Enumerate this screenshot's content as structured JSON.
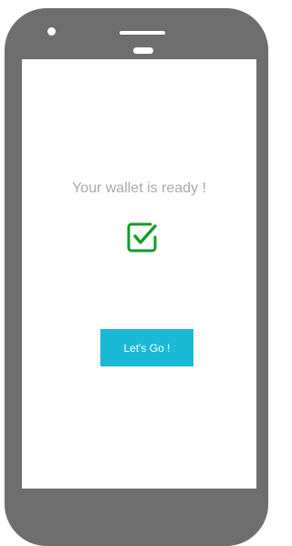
{
  "screen": {
    "message": "Your wallet is ready !",
    "icon": "checkbox-checked-icon",
    "cta_label": "Let's Go !"
  },
  "colors": {
    "device_frame": "#6e6e6e",
    "screen_bg": "#ffffff",
    "message_text": "#a9a9a9",
    "check_icon": "#119c2a",
    "cta_bg": "#1ab9d6",
    "cta_text": "#ffffff"
  }
}
